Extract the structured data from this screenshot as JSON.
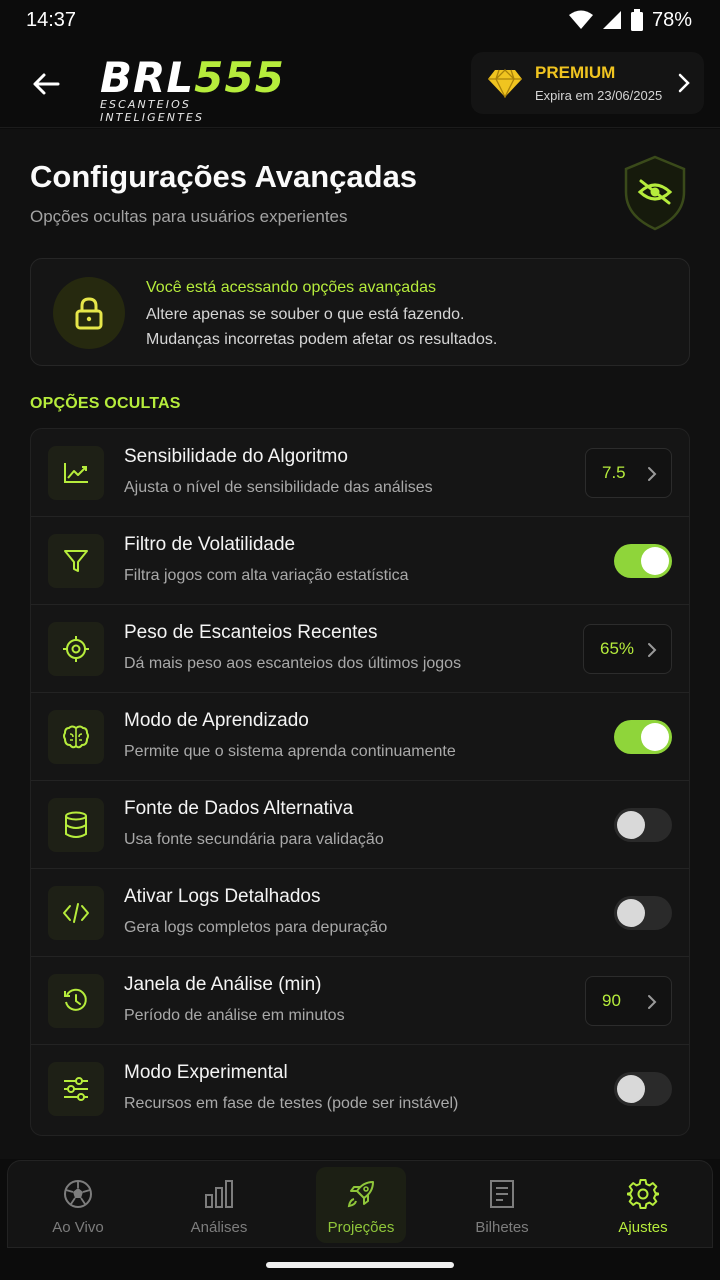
{
  "status": {
    "time": "14:37",
    "battery": "78%"
  },
  "header": {
    "logo_white": "BRL",
    "logo_green": "555",
    "logo_sub": "ESCANTEIOS INTELIGENTES",
    "premium_title": "PREMIUM",
    "premium_expiry": "Expira em 23/06/2025"
  },
  "page": {
    "title": "Configurações Avançadas",
    "subtitle": "Opções ocultas para usuários experientes"
  },
  "warning": {
    "title": "Você está acessando opções avançadas",
    "line1": "Altere apenas se souber o que está fazendo.",
    "line2": "Mudanças incorretas podem afetar os resultados."
  },
  "section_label": "OPÇÕES OCULTAS",
  "options": [
    {
      "icon": "line-chart-icon",
      "title": "Sensibilidade do Algoritmo",
      "desc": "Ajusta o nível de sensibilidade das análises",
      "control": "value",
      "value": "7.5"
    },
    {
      "icon": "funnel-icon",
      "title": "Filtro de Volatilidade",
      "desc": "Filtra jogos com alta variação estatística",
      "control": "toggle",
      "on": true
    },
    {
      "icon": "target-icon",
      "title": "Peso de Escanteios Recentes",
      "desc": "Dá mais peso aos escanteios dos últimos jogos",
      "control": "value",
      "value": "65%"
    },
    {
      "icon": "brain-icon",
      "title": "Modo de Aprendizado",
      "desc": "Permite que o sistema aprenda continuamente",
      "control": "toggle",
      "on": true
    },
    {
      "icon": "database-icon",
      "title": "Fonte de Dados Alternativa",
      "desc": "Usa fonte secundária para validação",
      "control": "toggle",
      "on": false
    },
    {
      "icon": "code-icon",
      "title": "Ativar Logs Detalhados",
      "desc": "Gera logs completos para depuração",
      "control": "toggle",
      "on": false
    },
    {
      "icon": "history-clock-icon",
      "title": "Janela de Análise (min)",
      "desc": "Período de análise em minutos",
      "control": "value",
      "value": "90"
    },
    {
      "icon": "sliders-icon",
      "title": "Modo Experimental",
      "desc": "Recursos em fase de testes (pode ser instável)",
      "control": "toggle",
      "on": false
    }
  ],
  "nav": [
    {
      "label": "Ao Vivo",
      "icon": "soccer-ball-icon"
    },
    {
      "label": "Análises",
      "icon": "bar-chart-icon"
    },
    {
      "label": "Projeções",
      "icon": "rocket-icon"
    },
    {
      "label": "Bilhetes",
      "icon": "ticket-icon"
    },
    {
      "label": "Ajustes",
      "icon": "gear-icon"
    }
  ],
  "colors": {
    "accent": "#b6ec3c",
    "toggle_on": "#8fd53a",
    "premium": "#f0c420",
    "background": "#111111"
  }
}
